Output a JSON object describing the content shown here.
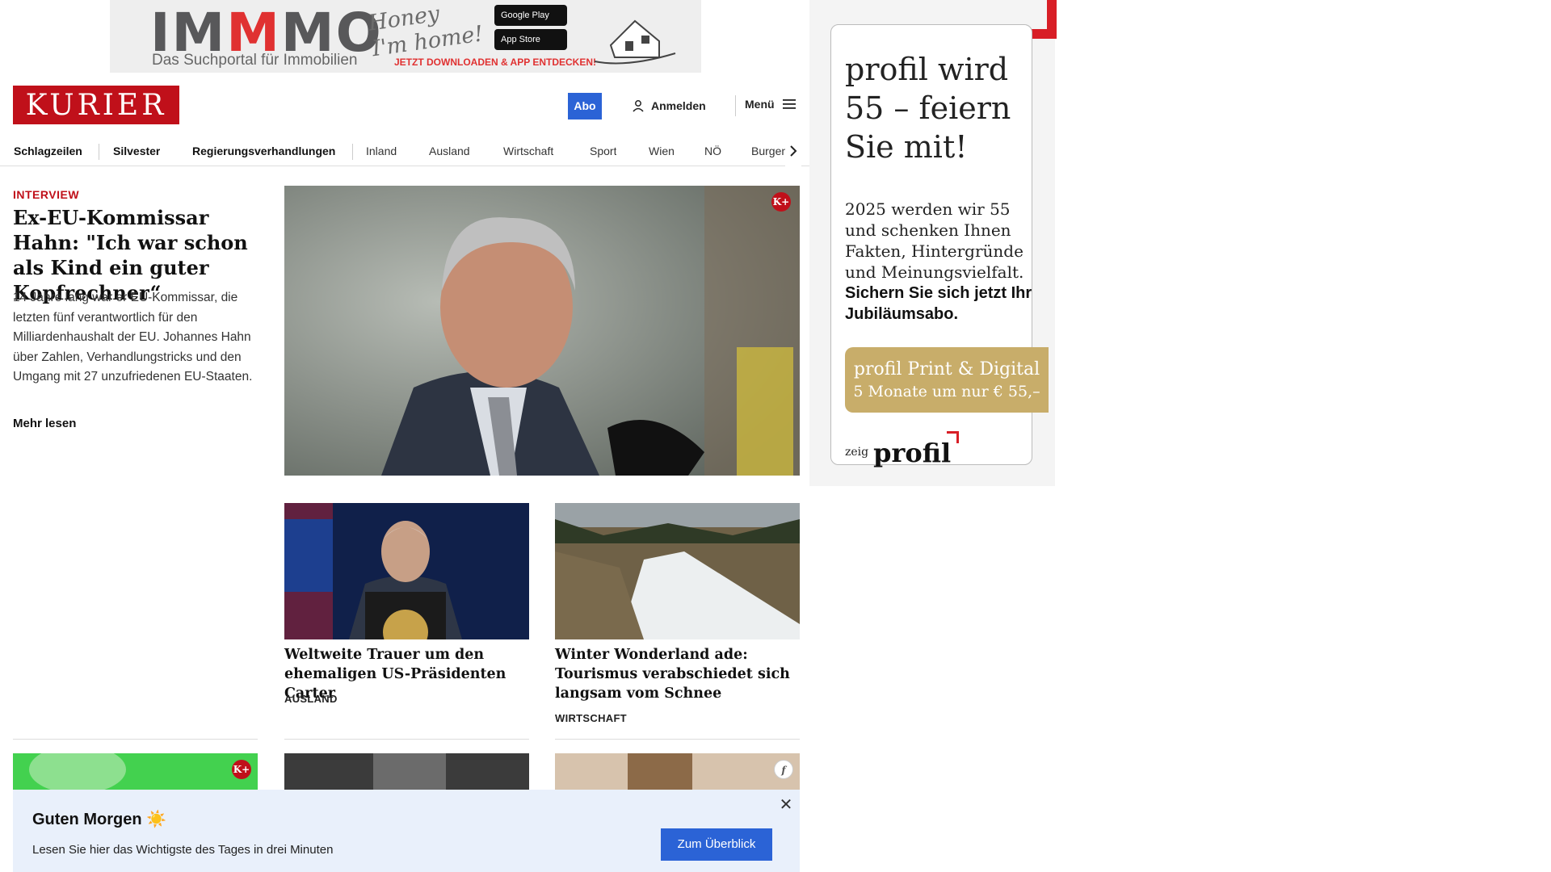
{
  "top_ad": {
    "brand_part1": "IM",
    "brand_part2": "M",
    "brand_part3": "MO",
    "subtitle": "Das Suchportal für Immobilien",
    "script_line1": "Honey",
    "script_line2": "I'm home!",
    "google_play": "Google Play",
    "app_store": "App Store",
    "cta": "JETZT DOWNLOADEN & APP ENTDECKEN!"
  },
  "header": {
    "logo": "KURIER",
    "abo": "Abo",
    "login": "Anmelden",
    "menu": "Menü"
  },
  "nav": {
    "items": [
      "Schlagzeilen",
      "Silvester",
      "Regierungsverhandlungen",
      "Inland",
      "Ausland",
      "Wirtschaft",
      "Sport",
      "Wien",
      "NÖ",
      "Burgenl"
    ]
  },
  "lead": {
    "kicker": "INTERVIEW",
    "title": "Ex-EU-Kommissar Hahn: \"Ich war schon als Kind ein guter Kopfrechner“",
    "text": "14 Jahre lang war er EU-Kommissar, die letzten fünf verantwortlich für den Milliardenhaushalt der EU. Johannes Hahn über Zahlen, Verhandlungstricks und den Umgang mit 27 unzufriedenen EU-Staaten.",
    "more": "Mehr lesen",
    "badge": "K+"
  },
  "cards": [
    {
      "title": "Weltweite Trauer um den ehemali­gen US-Präsidenten Carter",
      "category": "AUSLAND"
    },
    {
      "title": "Winter Wonderland ade: Touris­mus verabschiedet sich langsam vom Schnee",
      "category": "WIRTSCHAFT"
    }
  ],
  "bottom_badges": {
    "left": "K+",
    "right": "f"
  },
  "morning": {
    "title": "Guten Morgen ☀️",
    "subtitle": "Lesen Sie hier das Wichtigste des Tages in drei Minuten",
    "button": "Zum Überblick",
    "close": "✕"
  },
  "right_ad": {
    "head": "profil wird 55 – feiern Sie mit!",
    "body": "2025 werden wir 55 und schenken Ihnen Fakten, Hintergründe und Meinungsvielfalt.",
    "body_bold": "Sichern Sie sich jetzt Ihr Jubiläumsabo.",
    "button_line1": "profil Print & Digital",
    "button_line2": "5 Monate um nur € 55,–",
    "footer_small": "zeig",
    "footer_brand": "profil"
  },
  "colors": {
    "brand_red": "#c0101a",
    "accent_blue": "#2b63d6",
    "ad_gold": "#c8ad6a",
    "morning_bg": "#e9f0fb"
  }
}
